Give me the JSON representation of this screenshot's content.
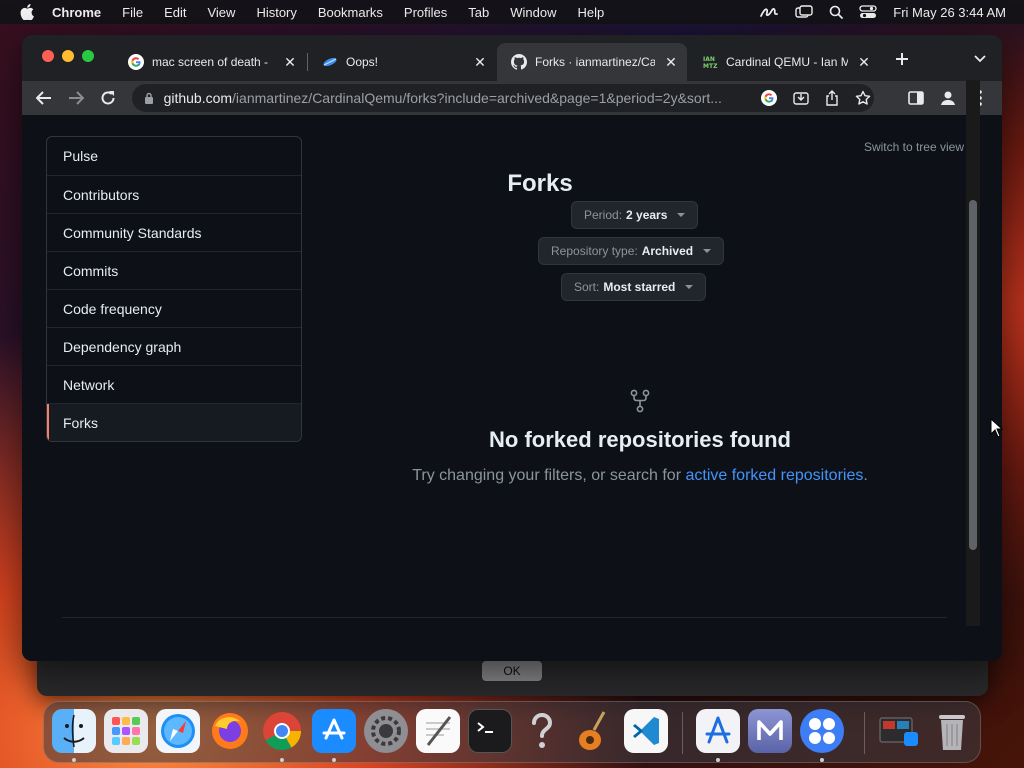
{
  "menubar": {
    "app_name": "Chrome",
    "items": [
      "File",
      "Edit",
      "View",
      "History",
      "Bookmarks",
      "Profiles",
      "Tab",
      "Window",
      "Help"
    ],
    "clock": "Fri May 26  3:44 AM",
    "status_icons": [
      "scribble-icon",
      "screen-mirroring-icon",
      "search-icon",
      "control-center-icon"
    ]
  },
  "browser": {
    "tabs": [
      {
        "title": "mac screen of death -",
        "favicon": "google-icon"
      },
      {
        "title": "Oops!",
        "favicon": "leaf-icon"
      },
      {
        "title": "Forks · ianmartinez/Ca",
        "favicon": "github-icon",
        "active": true
      },
      {
        "title": "Cardinal QEMU - Ian M",
        "favicon": "ian-mtz-icon"
      }
    ],
    "url_host": "github.com",
    "url_path": "/ianmartinez/CardinalQemu/forks?include=archived&page=1&period=2y&sort..."
  },
  "sidebar": {
    "items": [
      {
        "label": "Pulse"
      },
      {
        "label": "Contributors"
      },
      {
        "label": "Community Standards"
      },
      {
        "label": "Commits"
      },
      {
        "label": "Code frequency"
      },
      {
        "label": "Dependency graph"
      },
      {
        "label": "Network"
      },
      {
        "label": "Forks",
        "selected": true
      }
    ]
  },
  "main": {
    "switch_tree_label": "Switch to tree view",
    "title": "Forks",
    "filters": {
      "period": {
        "label": "Period:",
        "value": "2 years"
      },
      "repo_type": {
        "label": "Repository type:",
        "value": "Archived"
      },
      "sort": {
        "label": "Sort:",
        "value": "Most starred"
      }
    },
    "empty_title": "No forked repositories found",
    "empty_desc_prefix": "Try changing your filters, or search for ",
    "empty_desc_link": "active forked repositories",
    "empty_desc_suffix": "."
  },
  "dialog": {
    "ok_label": "OK"
  },
  "dock": {
    "apps": [
      "finder",
      "launchpad",
      "safari",
      "firefox",
      "chrome",
      "app-store",
      "system-preferences",
      "textedit",
      "terminal",
      "help",
      "garageband",
      "vscode",
      "xcode-instruments",
      "utm",
      "multi-app",
      "screenshot",
      "trash"
    ]
  },
  "colors": {
    "accent_link": "#4493f8",
    "selected_marker": "#f78166",
    "page_bg": "#0d1117"
  }
}
